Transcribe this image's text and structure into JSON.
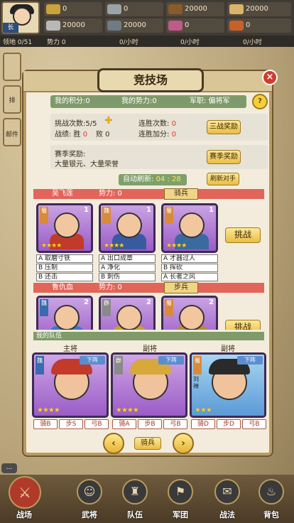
{
  "player": {
    "level_tag": "长"
  },
  "resources": {
    "r1": "0",
    "r2": "0",
    "r3": "20000",
    "r4": "20000",
    "r5": "20000",
    "r6": "20000",
    "r7": "0",
    "r8": "0"
  },
  "status_row": {
    "territory": "领地 0/51",
    "power": "势力 0",
    "t1": "0/小时",
    "t2": "0/小时",
    "t3": "0/小时",
    "t4": "0/小时"
  },
  "sidebar": {
    "item1": "排",
    "item2": "邮件"
  },
  "dialog": {
    "title": "竞技场",
    "close": "×",
    "info": {
      "points": "我的积分:0",
      "power": "我的势力:0",
      "rank": "军职: 偏将军"
    },
    "help": "?",
    "stats": {
      "challenges_label": "挑战次数:5/5",
      "record_label": "战绩: 胜",
      "wins": "0",
      "loss_label": "败 0",
      "streak_label": "连胜次数:",
      "streak": "0",
      "streak_bonus_label": "连胜加分:",
      "streak_bonus": "0",
      "three_reward_btn": "三战奖励"
    },
    "season": {
      "label": "赛季奖励:",
      "desc": "大量银元、大量荣誉",
      "btn": "赛季奖励"
    },
    "refresh": {
      "label": "自动刷新:",
      "time": "04 : 28",
      "btn": "刷新对手"
    },
    "opponents": [
      {
        "name": "吴飞莲",
        "power": "势力: 0",
        "type": "骑兵",
        "cards": [
          {
            "faction": "蜀",
            "level": "1",
            "skills": [
              "A 取磨寸铁",
              "B 压制",
              "B 还击"
            ]
          },
          {
            "faction": "魏",
            "level": "1",
            "skills": [
              "A 出口成章",
              "A 净化",
              "B 刺伤"
            ]
          },
          {
            "faction": "蜀",
            "level": "1",
            "skills": [
              "A 才器过人",
              "B 挥砍",
              "A 长者之风"
            ]
          }
        ],
        "btn": "挑战"
      },
      {
        "name": "鲁仇血",
        "power": "势力: 0",
        "type": "步兵",
        "cards": [
          {
            "faction": "魏",
            "level": "2"
          },
          {
            "faction": "群",
            "level": "2"
          },
          {
            "faction": "蜀",
            "level": "2"
          }
        ],
        "btn": "挑战"
      }
    ],
    "team": {
      "label": "我的队伍",
      "roles": [
        "主将",
        "副将",
        "副将"
      ],
      "members": [
        {
          "faction": "魏",
          "down": "下阵",
          "slots": [
            "骑B",
            "步S",
            "弓B"
          ]
        },
        {
          "faction": "群",
          "down": "下阵",
          "slots": [
            "骑A",
            "步B",
            "弓B"
          ]
        },
        {
          "faction": "蜀",
          "name": "刘禅",
          "down": "下阵",
          "slots": [
            "骑D",
            "步D",
            "弓B"
          ]
        }
      ],
      "mode": "骑兵"
    }
  },
  "chat": "...",
  "nav": [
    "战场",
    "武将",
    "队伍",
    "军团",
    "战法",
    "背包"
  ],
  "colors": {
    "accent": "#e2655a",
    "green": "#7f9a6a",
    "gold": "#e9bd45",
    "card": "#9a5cc6"
  }
}
